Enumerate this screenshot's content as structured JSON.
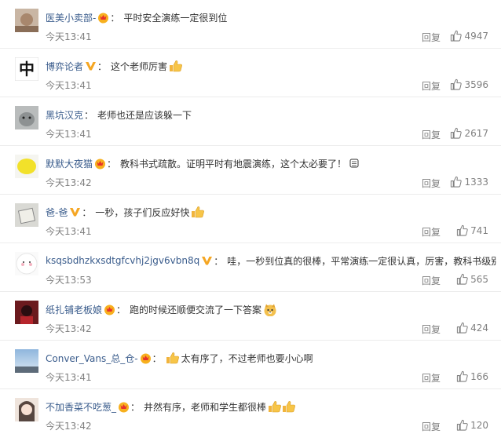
{
  "colors": {
    "username": "#eb7350",
    "time": "#808080",
    "text": "#333333",
    "divider": "#ececec"
  },
  "comments": [
    {
      "username": "医美小卖部-",
      "badge": "crown-badge",
      "text": "平时安全演练一定很到位",
      "emojis": [],
      "time": "今天13:41",
      "reply": "回复",
      "likes": "4947"
    },
    {
      "username": "博弈论者",
      "badge": "v-badge",
      "text": "这个老师厉害",
      "emojis": [
        "thumbs-up"
      ],
      "time": "今天13:41",
      "reply": "回复",
      "likes": "3596"
    },
    {
      "username": "黑坑汉克",
      "badge": "",
      "text": "老师也还是应该躲一下",
      "emojis": [],
      "time": "今天13:41",
      "reply": "回复",
      "likes": "2617"
    },
    {
      "username": "默默大夜猫",
      "badge": "crown-badge",
      "text": "教科书式疏散。证明平时有地震演练，这个太必要了！",
      "emojis": [
        "fist"
      ],
      "time": "今天13:42",
      "reply": "回复",
      "likes": "1333"
    },
    {
      "username": "爸-爸",
      "badge": "v-badge",
      "text": "一秒，孩子们反应好快",
      "emojis": [
        "thumbs-up"
      ],
      "time": "今天13:41",
      "reply": "回复",
      "likes": "741"
    },
    {
      "username": "ksqsbdhzkxsdtgfcvhj2jgv6vbn8q",
      "badge": "v-badge",
      "text": "哇，一秒到位真的很棒，平常演练一定很认真，厉害，教科书级别的",
      "emojis": [],
      "time": "今天13:53",
      "reply": "回复",
      "likes": "565"
    },
    {
      "username": "纸扎铺老板娘",
      "badge": "crown-badge",
      "text": "跑的时候还顺便交流了一下答案",
      "emojis": [
        "doge"
      ],
      "time": "今天13:42",
      "reply": "回复",
      "likes": "424"
    },
    {
      "username": "Conver_Vans_总_仓-",
      "badge": "crown-badge",
      "text": "太有序了，不过老师也要小心啊",
      "emojis": [
        "thumbs-up-before"
      ],
      "time": "今天13:41",
      "reply": "回复",
      "likes": "166"
    },
    {
      "username": "不加香菜不吃葱_",
      "badge": "crown-badge",
      "text": "井然有序，老师和学生都很棒",
      "emojis": [
        "thumbs-up",
        "thumbs-up"
      ],
      "time": "今天13:42",
      "reply": "回复",
      "likes": "120"
    }
  ]
}
